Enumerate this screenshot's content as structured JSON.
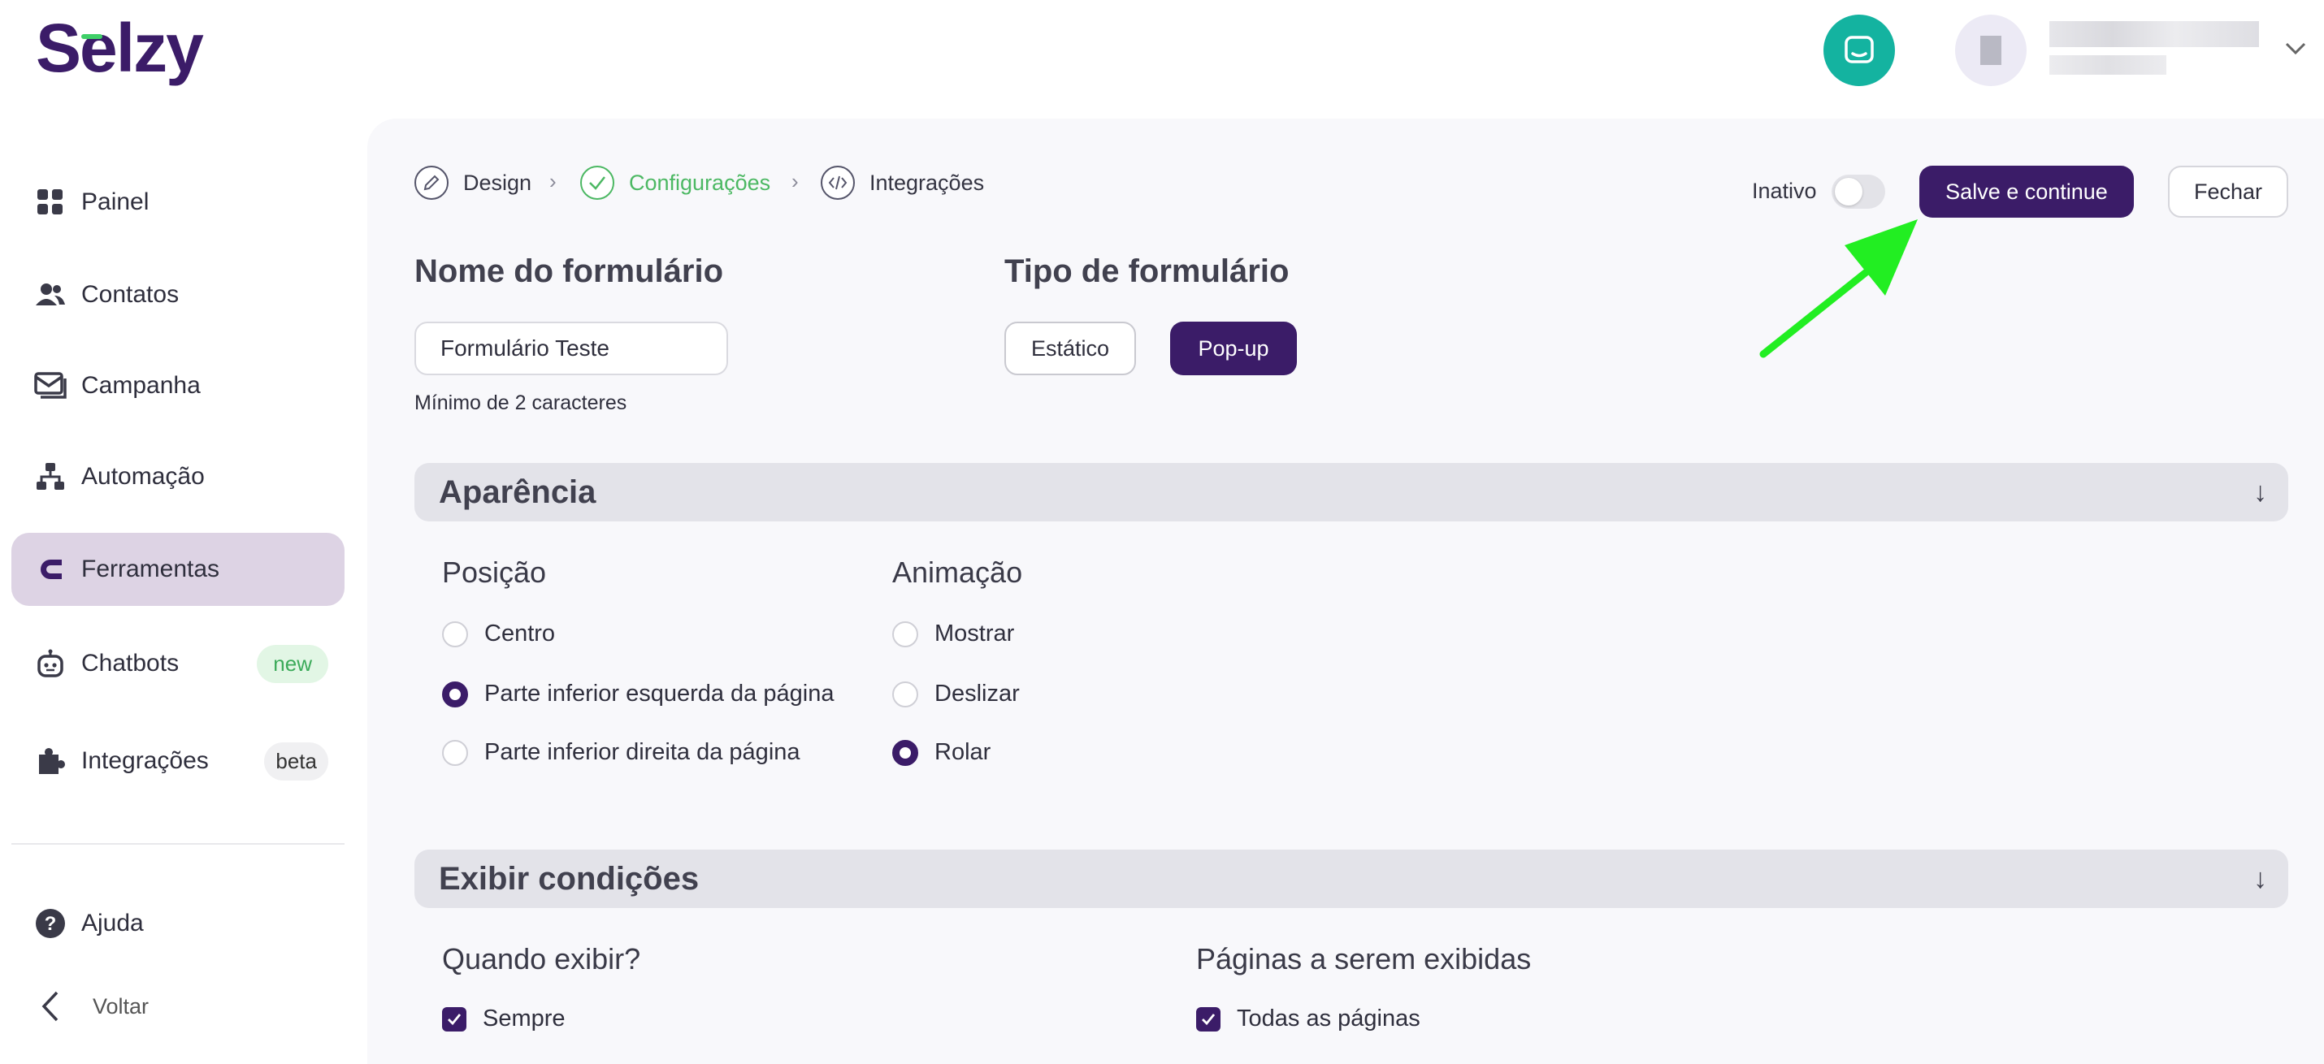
{
  "brand": {
    "logo_text": "Selzy",
    "accent_color": "#3b1c68"
  },
  "sidebar": {
    "items": [
      {
        "label": "Painel",
        "icon": "grid-icon"
      },
      {
        "label": "Contatos",
        "icon": "contacts-icon"
      },
      {
        "label": "Campanha",
        "icon": "mail-icon"
      },
      {
        "label": "Automação",
        "icon": "automation-icon"
      },
      {
        "label": "Ferramentas",
        "icon": "magnet-icon",
        "active": true
      },
      {
        "label": "Chatbots",
        "icon": "bot-icon",
        "badge": "new"
      },
      {
        "label": "Integrações",
        "icon": "puzzle-icon",
        "badge": "beta"
      }
    ],
    "help_label": "Ajuda",
    "back_label": "Voltar"
  },
  "steps": [
    {
      "label": "Design",
      "icon": "pencil-icon",
      "state": "default"
    },
    {
      "label": "Configurações",
      "icon": "check-icon",
      "state": "done"
    },
    {
      "label": "Integrações",
      "icon": "code-icon",
      "state": "default"
    }
  ],
  "toolbar": {
    "status_label": "Inativo",
    "status_on": false,
    "save_label": "Salve e continue",
    "close_label": "Fechar"
  },
  "form_name": {
    "title": "Nome do formulário",
    "value": "Formulário Teste",
    "hint": "Mínimo de 2 caracteres"
  },
  "form_type": {
    "title": "Tipo de formulário",
    "options": [
      "Estático",
      "Pop-up"
    ],
    "selected": "Pop-up"
  },
  "appearance": {
    "title": "Aparência",
    "position": {
      "title": "Posição",
      "options": [
        "Centro",
        "Parte inferior esquerda da página",
        "Parte inferior direita da página"
      ],
      "selected": "Parte inferior esquerda da página"
    },
    "animation": {
      "title": "Animação",
      "options": [
        "Mostrar",
        "Deslizar",
        "Rolar"
      ],
      "selected": "Rolar"
    }
  },
  "display_conditions": {
    "title": "Exibir condições",
    "when": {
      "title": "Quando exibir?",
      "option": "Sempre",
      "checked": true
    },
    "pages": {
      "title": "Páginas a serem exibidas",
      "option": "Todas as páginas",
      "checked": true
    }
  },
  "annotation_color": "#22ee22"
}
